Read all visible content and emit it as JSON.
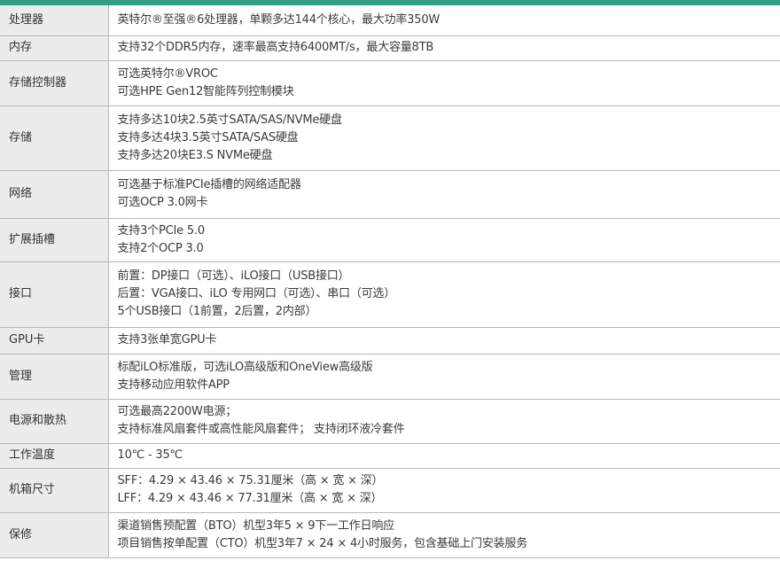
{
  "accent_color": "#2f9e84",
  "rows": [
    {
      "label": "处理器",
      "lines": [
        "英特尔®至强®6处理器，单颗多达144个核心，最大功率350W"
      ]
    },
    {
      "label": "内存",
      "lines": [
        "支持32个DDR5内存，速率最高支持6400MT/s，最大容量8TB"
      ]
    },
    {
      "label": "存储控制器",
      "lines": [
        "可选英特尔®VROC",
        "可选HPE Gen12智能阵列控制模块"
      ]
    },
    {
      "label": "存储",
      "lines": [
        "支持多达10块2.5英寸SATA/SAS/NVMe硬盘",
        "支持多达4块3.5英寸SATA/SAS硬盘",
        "支持多达20块E3.S NVMe硬盘"
      ]
    },
    {
      "label": "网络",
      "lines": [
        "可选基于标准PCIe插槽的网络适配器",
        "可选OCP 3.0网卡"
      ]
    },
    {
      "label": "扩展插槽",
      "lines": [
        "支持3个PCIe 5.0",
        "支持2个OCP 3.0"
      ]
    },
    {
      "label": "接口",
      "lines": [
        "前置：DP接口（可选）、iLO接口（USB接口）",
        "后置：VGA接口、iLO 专用网口（可选）、串口（可选）",
        "5个USB接口（1前置，2后置，2内部）"
      ]
    },
    {
      "label": "GPU卡",
      "lines": [
        "支持3张单宽GPU卡"
      ]
    },
    {
      "label": "管理",
      "lines": [
        "标配iLO标准版，可选iLO高级版和OneView高级版",
        "支持移动应用软件APP"
      ]
    },
    {
      "label": "电源和散热",
      "lines": [
        "可选最高2200W电源；",
        "支持标准风扇套件或高性能风扇套件； 支持闭环液冷套件"
      ]
    },
    {
      "label": "工作温度",
      "lines": [
        "10℃ - 35℃"
      ]
    },
    {
      "label": "机箱尺寸",
      "lines": [
        "SFF：4.29 × 43.46 × 75.31厘米（高 × 宽 × 深）",
        "LFF：4.29 × 43.46 × 77.31厘米（高 × 宽 × 深）"
      ]
    },
    {
      "label": "保修",
      "lines": [
        "渠道销售预配置（BTO）机型3年5 × 9下一工作日响应",
        "项目销售按单配置（CTO）机型3年7 × 24 × 4小时服务，包含基础上门安装服务"
      ]
    }
  ]
}
